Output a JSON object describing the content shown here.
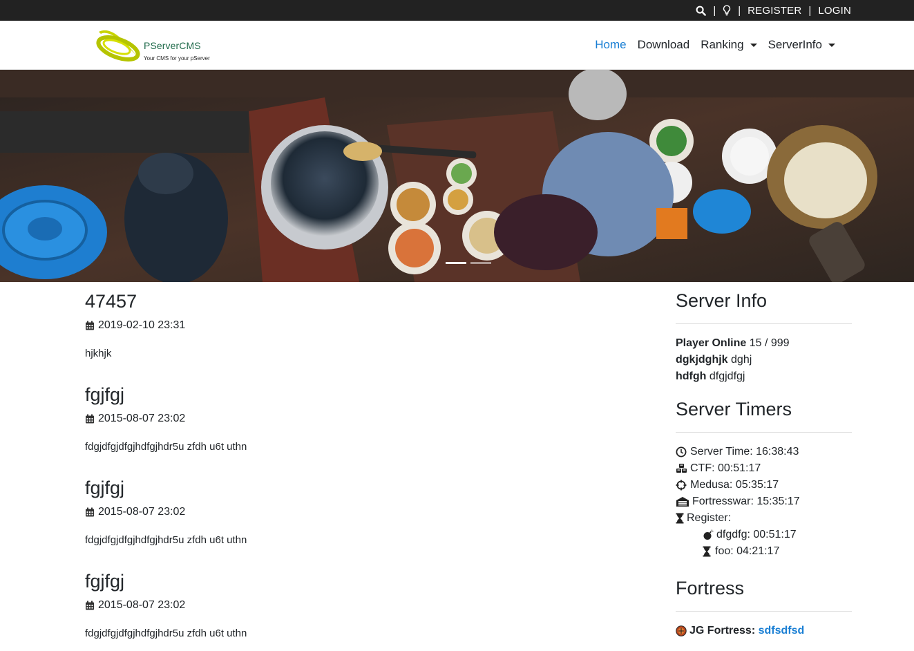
{
  "topbar": {
    "register": "REGISTER",
    "login": "LOGIN",
    "separator": "|"
  },
  "brand": {
    "name": "PServerCMS",
    "tagline": "Your CMS for your pServer"
  },
  "nav": {
    "home": "Home",
    "download": "Download",
    "ranking": "Ranking",
    "serverinfo": "ServerInfo"
  },
  "carousel": {
    "slides": 2,
    "active": 1
  },
  "posts": [
    {
      "title": "47457",
      "date": "2019-02-10 23:31",
      "body": "hjkhjk"
    },
    {
      "title": "fgjfgj",
      "date": "2015-08-07 23:02",
      "body": "fdgjdfgjdfgjhdfgjhdr5u zfdh  u6t uthn"
    },
    {
      "title": "fgjfgj",
      "date": "2015-08-07 23:02",
      "body": "fdgjdfgjdfgjhdfgjhdr5u zfdh  u6t uthn"
    },
    {
      "title": "fgjfgj",
      "date": "2015-08-07 23:02",
      "body": "fdgjdfgjdfgjhdfgjhdr5u zfdh  u6t uthn"
    }
  ],
  "server_info": {
    "heading": "Server Info",
    "rows": [
      {
        "label": "Player Online",
        "value": "15 / 999"
      },
      {
        "label": "dgkjdghjk",
        "value": "dghj"
      },
      {
        "label": "hdfgh",
        "value": "dfgjdfgj"
      }
    ]
  },
  "server_timers": {
    "heading": "Server Timers",
    "server_time": "Server Time: 16:38:43",
    "ctf": "CTF: 00:51:17",
    "medusa": "Medusa: 05:35:17",
    "fortresswar": "Fortresswar: 15:35:17",
    "register": "Register:",
    "register_items": [
      {
        "text": "dfgdfg: 00:51:17",
        "icon": "bomb-icon"
      },
      {
        "text": "foo: 04:21:17",
        "icon": "hourglass-icon"
      }
    ]
  },
  "fortress": {
    "heading": "Fortress",
    "label": "JG Fortress:",
    "owner": "sdfsdfsd"
  },
  "colors": {
    "accent": "#1a7fd4",
    "topbar": "#222222"
  }
}
